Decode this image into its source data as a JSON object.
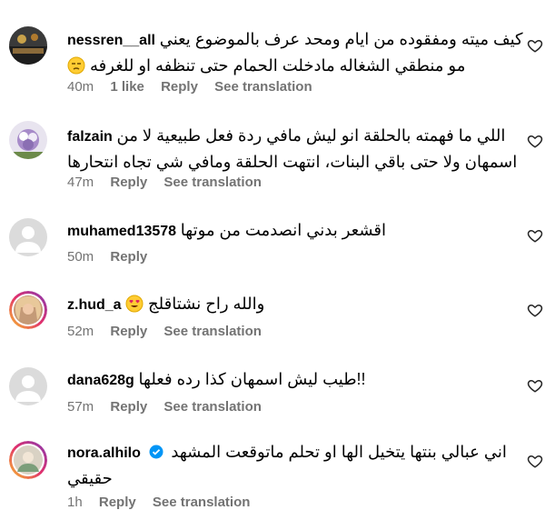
{
  "comments": [
    {
      "username": "nessren__all",
      "text_line1": "كيف ميته ومفقوده من ايام ومحد عرف بالموضوع يعني",
      "text_line2": "مو منطقي الشغاله مادخلت الحمام حتى تنظفه او للغرفه",
      "time": "40m",
      "likes": "1 like",
      "reply": "Reply",
      "translate": "See translation"
    },
    {
      "username": "falzain",
      "text_line1": "اللي ما فهمته بالحلقة انو ليش مافي ردة فعل طبيعية لا من",
      "text_line2": "اسمهان ولا حتى باقي البنات، انتهت الحلقة ومافي شي تجاه انتحارها",
      "time": "47m",
      "reply": "Reply",
      "translate": "See translation"
    },
    {
      "username": "muhamed13578",
      "text_line1": "اقشعر بدني انصدمت من موتها",
      "time": "50m",
      "reply": "Reply"
    },
    {
      "username": "z.hud_a",
      "text_line1": "والله راح نشتاقلج",
      "time": "52m",
      "reply": "Reply",
      "translate": "See translation"
    },
    {
      "username": "dana628g",
      "text_line1": "طيب ليش اسمهان كذا رده فعلها!!",
      "time": "57m",
      "reply": "Reply",
      "translate": "See translation"
    },
    {
      "username": "nora.alhilo",
      "text_line1": "اني عبالي بنتها يتخيل الها او تحلم ماتوقعت المشهد",
      "text_line2": "حقيقي",
      "time": "1h",
      "reply": "Reply",
      "translate": "See translation"
    }
  ],
  "icons": {
    "heart": "heart-outline-icon",
    "verified": "verified-badge-icon",
    "emoji_unamused": "unamused-face-emoji",
    "emoji_hearteyes": "heart-eyes-emoji"
  },
  "colors": {
    "meta": "#737373",
    "verified": "#0095f6"
  }
}
